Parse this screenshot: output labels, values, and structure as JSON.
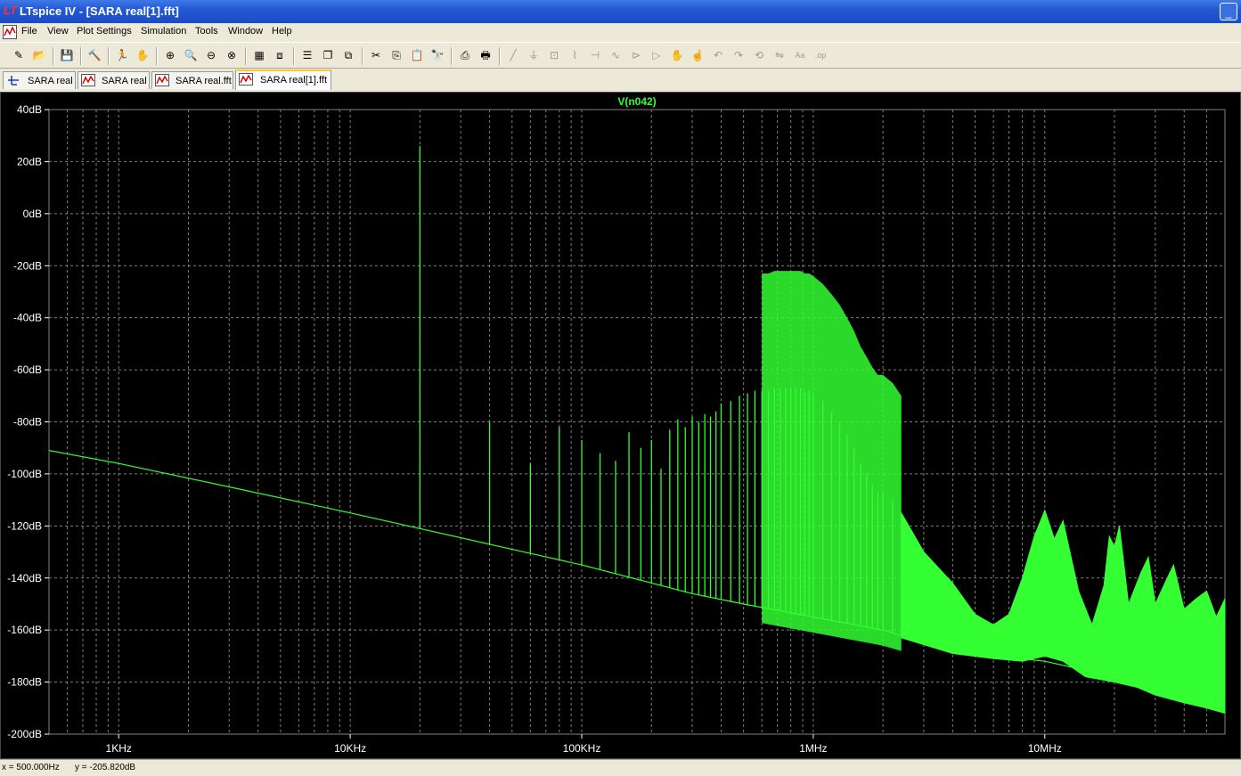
{
  "window": {
    "app_icon": "LT",
    "title": "LTspice IV - [SARA real[1].fft]",
    "minimize_glyph": "_"
  },
  "menu": [
    "File",
    "View",
    "Plot Settings",
    "Simulation",
    "Tools",
    "Window",
    "Help"
  ],
  "toolbar": [
    {
      "icon": "new-schematic-icon",
      "glyph": "✎",
      "enabled": true
    },
    {
      "icon": "open-icon",
      "glyph": "📂",
      "enabled": true
    },
    {
      "sep": true
    },
    {
      "icon": "save-icon",
      "glyph": "💾",
      "enabled": true
    },
    {
      "sep": true
    },
    {
      "icon": "control-panel-icon",
      "glyph": "🔨",
      "enabled": true
    },
    {
      "sep": true
    },
    {
      "icon": "run-icon",
      "glyph": "🏃",
      "enabled": false
    },
    {
      "icon": "pan-icon",
      "glyph": "✋",
      "enabled": false
    },
    {
      "sep": true
    },
    {
      "icon": "zoom-in-icon",
      "glyph": "⊕",
      "enabled": true
    },
    {
      "icon": "zoom-back-icon",
      "glyph": "🔍",
      "enabled": true
    },
    {
      "icon": "zoom-out-icon",
      "glyph": "⊖",
      "enabled": true
    },
    {
      "icon": "zoom-fit-icon",
      "glyph": "⊗",
      "enabled": true
    },
    {
      "sep": true
    },
    {
      "icon": "autorange-icon",
      "glyph": "▦",
      "enabled": true
    },
    {
      "icon": "fit-icon",
      "glyph": "⧈",
      "enabled": true
    },
    {
      "sep": true
    },
    {
      "icon": "tile-horizontal-icon",
      "glyph": "☰",
      "enabled": true
    },
    {
      "icon": "cascade-icon",
      "glyph": "❐",
      "enabled": true
    },
    {
      "icon": "close-windows-icon",
      "glyph": "⧉",
      "enabled": true
    },
    {
      "sep": true
    },
    {
      "icon": "cut-icon",
      "glyph": "✂",
      "enabled": true
    },
    {
      "icon": "copy-icon",
      "glyph": "⎘",
      "enabled": true
    },
    {
      "icon": "paste-icon",
      "glyph": "📋",
      "enabled": true
    },
    {
      "icon": "find-icon",
      "glyph": "🔭",
      "enabled": true
    },
    {
      "sep": true
    },
    {
      "icon": "print-preview-icon",
      "glyph": "⎙",
      "enabled": true
    },
    {
      "icon": "print-icon",
      "glyph": "🖶",
      "enabled": true
    },
    {
      "sep": true
    },
    {
      "icon": "wire-icon",
      "glyph": "╱",
      "enabled": false
    },
    {
      "icon": "ground-icon",
      "glyph": "⏚",
      "enabled": false
    },
    {
      "icon": "label-icon",
      "glyph": "⊡",
      "enabled": false
    },
    {
      "icon": "resistor-icon",
      "glyph": "⌇",
      "enabled": false
    },
    {
      "icon": "capacitor-icon",
      "glyph": "⊣",
      "enabled": false
    },
    {
      "icon": "inductor-icon",
      "glyph": "∿",
      "enabled": false
    },
    {
      "icon": "diode-icon",
      "glyph": "⊳",
      "enabled": false
    },
    {
      "icon": "component-icon",
      "glyph": "▷",
      "enabled": false
    },
    {
      "icon": "move-icon",
      "glyph": "✋",
      "enabled": false
    },
    {
      "icon": "drag-icon",
      "glyph": "☝",
      "enabled": false
    },
    {
      "icon": "undo-icon",
      "glyph": "↶",
      "enabled": false
    },
    {
      "icon": "redo-icon",
      "glyph": "↷",
      "enabled": false
    },
    {
      "icon": "rotate-icon",
      "glyph": "⟲",
      "enabled": false
    },
    {
      "icon": "mirror-icon",
      "glyph": "⇋",
      "enabled": false
    },
    {
      "icon": "text-icon",
      "glyph": "Aa",
      "enabled": false
    },
    {
      "icon": "spice-directive-icon",
      "glyph": ".op",
      "enabled": false
    }
  ],
  "tabs": [
    {
      "label": "SARA real",
      "kind": "schematic",
      "active": false
    },
    {
      "label": "SARA real",
      "kind": "waveform",
      "active": false
    },
    {
      "label": "SARA real.fft",
      "kind": "waveform",
      "active": false
    },
    {
      "label": "SARA real[1].fft",
      "kind": "waveform",
      "active": true
    }
  ],
  "colors": {
    "trace": "#33ff33",
    "grid": "#7f7f7f",
    "axis_text": "#ffffff",
    "plot_bg": "#000000"
  },
  "status": {
    "x": "x = 500.000Hz",
    "y": "y = -205.820dB"
  },
  "chart_data": {
    "type": "line",
    "title": "V(n042)",
    "xlabel": "",
    "ylabel": "",
    "x_scale": "log",
    "xlim": [
      500,
      60000000
    ],
    "ylim": [
      -200,
      40
    ],
    "grid": true,
    "x_ticks": [
      {
        "value": 1000,
        "label": "1KHz"
      },
      {
        "value": 10000,
        "label": "10KHz"
      },
      {
        "value": 100000,
        "label": "100KHz"
      },
      {
        "value": 1000000,
        "label": "1MHz"
      },
      {
        "value": 10000000,
        "label": "10MHz"
      }
    ],
    "y_ticks": [
      {
        "value": 40,
        "label": "40dB"
      },
      {
        "value": 20,
        "label": "20dB"
      },
      {
        "value": 0,
        "label": "0dB"
      },
      {
        "value": -20,
        "label": "-20dB"
      },
      {
        "value": -40,
        "label": "-40dB"
      },
      {
        "value": -60,
        "label": "-60dB"
      },
      {
        "value": -80,
        "label": "-80dB"
      },
      {
        "value": -100,
        "label": "-100dB"
      },
      {
        "value": -120,
        "label": "-120dB"
      },
      {
        "value": -140,
        "label": "-140dB"
      },
      {
        "value": -160,
        "label": "-160dB"
      },
      {
        "value": -180,
        "label": "-180dB"
      },
      {
        "value": -200,
        "label": "-200dB"
      }
    ],
    "series": [
      {
        "name": "V(n042)",
        "noise_floor": [
          [
            500,
            -91
          ],
          [
            1000,
            -96
          ],
          [
            3000,
            -105
          ],
          [
            10000,
            -115
          ],
          [
            20000,
            -121
          ],
          [
            50000,
            -129
          ],
          [
            100000,
            -135
          ],
          [
            300000,
            -146
          ],
          [
            500000,
            -150
          ],
          [
            1000000,
            -155
          ],
          [
            2000000,
            -160
          ],
          [
            4000000,
            -168
          ],
          [
            10000000,
            -172
          ],
          [
            20000000,
            -178
          ],
          [
            60000000,
            -185
          ]
        ],
        "spikes": [
          [
            20000,
            26
          ],
          [
            40000,
            -80
          ],
          [
            60000,
            -96
          ],
          [
            80000,
            -82
          ],
          [
            100000,
            -87
          ],
          [
            120000,
            -92
          ],
          [
            140000,
            -95
          ],
          [
            160000,
            -84
          ],
          [
            180000,
            -90
          ],
          [
            200000,
            -87
          ],
          [
            220000,
            -98
          ],
          [
            240000,
            -83
          ],
          [
            260000,
            -79
          ],
          [
            280000,
            -82
          ],
          [
            300000,
            -78
          ],
          [
            320000,
            -80
          ],
          [
            340000,
            -77
          ],
          [
            360000,
            -78
          ],
          [
            380000,
            -76
          ],
          [
            400000,
            -73
          ],
          [
            440000,
            -72
          ],
          [
            480000,
            -70
          ],
          [
            520000,
            -69
          ],
          [
            560000,
            -68
          ],
          [
            600000,
            -68
          ],
          [
            640000,
            -68
          ],
          [
            680000,
            -67
          ],
          [
            720000,
            -67
          ],
          [
            760000,
            -67
          ],
          [
            800000,
            -67
          ],
          [
            840000,
            -67
          ],
          [
            880000,
            -67
          ],
          [
            920000,
            -68
          ],
          [
            960000,
            -68
          ],
          [
            1000000,
            -69
          ],
          [
            1100000,
            -72
          ],
          [
            1200000,
            -76
          ],
          [
            1300000,
            -80
          ],
          [
            1400000,
            -85
          ],
          [
            1500000,
            -90
          ],
          [
            1600000,
            -96
          ],
          [
            1700000,
            -100
          ],
          [
            1800000,
            -104
          ],
          [
            1900000,
            -107
          ],
          [
            2000000,
            -107
          ],
          [
            2200000,
            -110
          ],
          [
            2400000,
            -115
          ]
        ],
        "upper_envelope": [
          [
            2400000,
            -115
          ],
          [
            3000000,
            -130
          ],
          [
            4000000,
            -142
          ],
          [
            5000000,
            -154
          ],
          [
            6000000,
            -158
          ],
          [
            7000000,
            -154
          ],
          [
            8000000,
            -140
          ],
          [
            9000000,
            -124
          ],
          [
            10000000,
            -114
          ],
          [
            11000000,
            -125
          ],
          [
            12000000,
            -118
          ],
          [
            14000000,
            -145
          ],
          [
            16000000,
            -158
          ],
          [
            18000000,
            -143
          ],
          [
            19000000,
            -124
          ],
          [
            20000000,
            -128
          ],
          [
            21000000,
            -120
          ],
          [
            23000000,
            -150
          ],
          [
            26000000,
            -138
          ],
          [
            28000000,
            -132
          ],
          [
            30000000,
            -150
          ],
          [
            33000000,
            -142
          ],
          [
            36000000,
            -135
          ],
          [
            40000000,
            -152
          ],
          [
            45000000,
            -148
          ],
          [
            50000000,
            -145
          ],
          [
            55000000,
            -155
          ],
          [
            60000000,
            -148
          ]
        ],
        "lower_envelope": [
          [
            2400000,
            -163
          ],
          [
            4000000,
            -169
          ],
          [
            6000000,
            -171
          ],
          [
            8000000,
            -172
          ],
          [
            10000000,
            -170
          ],
          [
            12000000,
            -172
          ],
          [
            15000000,
            -178
          ],
          [
            20000000,
            -180
          ],
          [
            25000000,
            -182
          ],
          [
            30000000,
            -185
          ],
          [
            40000000,
            -188
          ],
          [
            50000000,
            -190
          ],
          [
            60000000,
            -192
          ]
        ]
      }
    ]
  }
}
